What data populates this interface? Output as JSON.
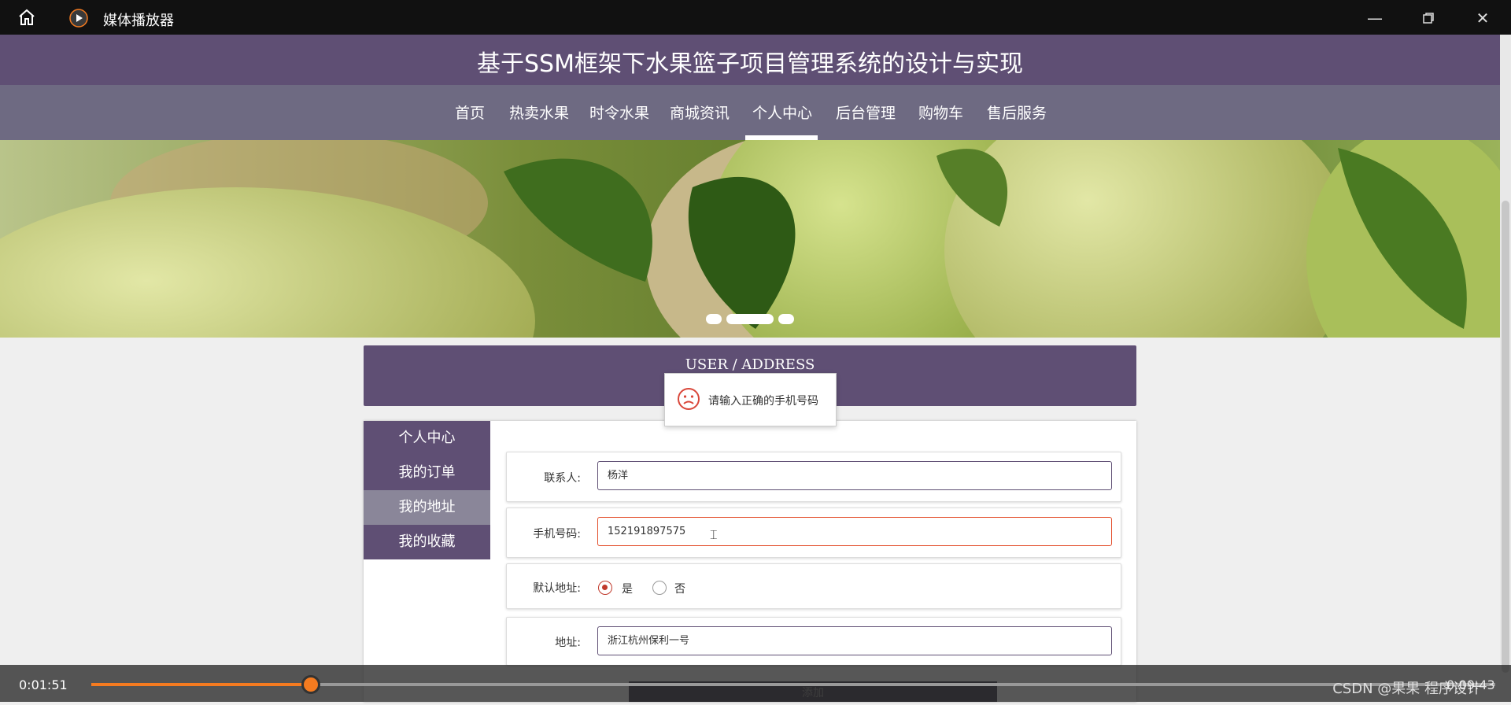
{
  "window": {
    "title": "媒体播放器"
  },
  "header": {
    "title": "基于SSM框架下水果篮子项目管理系统的设计与实现"
  },
  "nav": [
    {
      "label": "首页"
    },
    {
      "label": "热卖水果"
    },
    {
      "label": "时令水果"
    },
    {
      "label": "商城资讯"
    },
    {
      "label": "个人中心",
      "active": true
    },
    {
      "label": "后台管理"
    },
    {
      "label": "购物车"
    },
    {
      "label": "售后服务"
    }
  ],
  "section": {
    "title": "USER / ADDRESS"
  },
  "toast": {
    "message": "请输入正确的手机号码",
    "icon": "sad-face-icon"
  },
  "sidebar": [
    {
      "label": "个人中心"
    },
    {
      "label": "我的订单"
    },
    {
      "label": "我的地址",
      "active": true
    },
    {
      "label": "我的收藏"
    }
  ],
  "form": {
    "contact_label": "联系人:",
    "contact_value": "杨洋",
    "phone_label": "手机号码:",
    "phone_value": "152191897575",
    "default_label": "默认地址:",
    "yes_label": "是",
    "no_label": "否",
    "address_label": "地址:",
    "address_value": "浙江杭州保利一号",
    "add_button": "添加"
  },
  "player": {
    "current_time": "0:01:51",
    "total_time": "0:09:43",
    "progress": 0.155,
    "watermark": "CSDN @果果 程序设计"
  },
  "colors": {
    "brand": "#5f4f74",
    "accent": "#f57b20",
    "error": "#e34d2a"
  }
}
